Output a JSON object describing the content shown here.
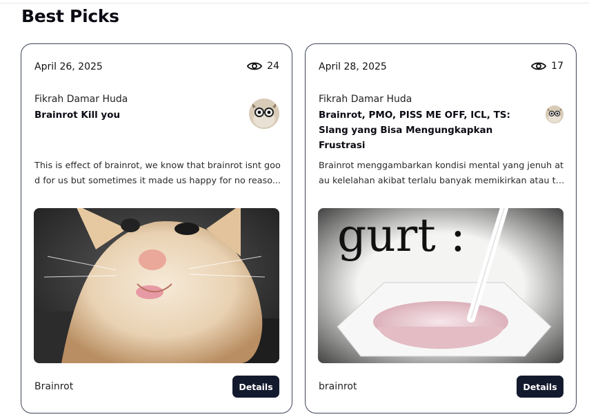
{
  "section": {
    "title": "Best Picks"
  },
  "cards": [
    {
      "date": "April 26, 2025",
      "views": "24",
      "author": "Fikrah Damar Huda",
      "title": "Brainrot Kill you",
      "excerpt_line1": "This is effect of brainrot, we know that brainrot isnt goo",
      "excerpt_line2": "d for us but sometimes it made us happy for no reaso...",
      "tag": "Brainrot",
      "button": "Details",
      "icons": {
        "views": "eye-icon",
        "avatar": "avatar-image",
        "media": "cat-meme-image"
      }
    },
    {
      "date": "April 28, 2025",
      "views": "17",
      "author": "Fikrah Damar Huda",
      "title": "Brainrot, PMO, PISS ME OFF, ICL, TS: Slang yang Bisa Mengungkapkan Frustrasi",
      "excerpt_line1": "Brainrot menggambarkan kondisi mental yang jenuh at",
      "excerpt_line2": "au kelelahan akibat terlalu banyak memikirkan atau te...",
      "tag": "brainrot",
      "button": "Details",
      "image_text": "gurt :",
      "icons": {
        "views": "eye-icon",
        "avatar": "avatar-image",
        "media": "yogurt-meme-image"
      }
    }
  ],
  "colors": {
    "button_bg": "#141a2e",
    "card_border": "#3b4257",
    "text": "#111111"
  }
}
